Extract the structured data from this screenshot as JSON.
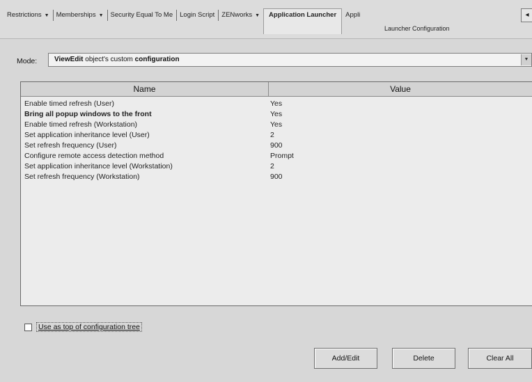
{
  "tabs": [
    {
      "label": "Restrictions",
      "dropdown": true
    },
    {
      "label": "Memberships",
      "dropdown": true
    },
    {
      "label": "Security Equal To Me",
      "dropdown": false
    },
    {
      "label": "Login Script",
      "dropdown": false
    },
    {
      "label": "ZENworks",
      "dropdown": true
    },
    {
      "label": "Application Launcher",
      "dropdown": false,
      "active": true
    },
    {
      "label": "Appli",
      "dropdown": false
    }
  ],
  "subtab": "Launcher Configuration",
  "scroll_icon": "left-arrow-icon",
  "mode": {
    "label": "Mode:",
    "value_bold1": "ViewEdit",
    "value_normal": " object's custom ",
    "value_bold2": "configuration"
  },
  "table": {
    "columns": [
      "Name",
      "Value"
    ],
    "rows": [
      {
        "name": "Enable timed refresh  (User)",
        "value": "Yes",
        "bold": false
      },
      {
        "name": "Bring all popup windows to the front",
        "value": "Yes",
        "bold": true
      },
      {
        "name": "Enable timed refresh (Workstation)",
        "value": "Yes",
        "bold": false
      },
      {
        "name": "Set application inheritance level (User)",
        "value": "2",
        "bold": false
      },
      {
        "name": "Set refresh frequency (User)",
        "value": "900",
        "bold": false
      },
      {
        "name": "Configure remote access detection method",
        "value": "Prompt",
        "bold": false
      },
      {
        "name": "Set application inheritance level (Workstation)",
        "value": "2",
        "bold": false
      },
      {
        "name": "Set refresh frequency (Workstation)",
        "value": "900",
        "bold": false
      }
    ]
  },
  "checkbox": {
    "label": "Use as top of configuration tree",
    "checked": false
  },
  "buttons": {
    "add_edit": "Add/Edit",
    "delete": "Delete",
    "clear_all": "Clear All"
  },
  "colors": {
    "background": "#d7d7d7",
    "table_bg": "#ececec",
    "header_bg": "#d3d3d3"
  }
}
